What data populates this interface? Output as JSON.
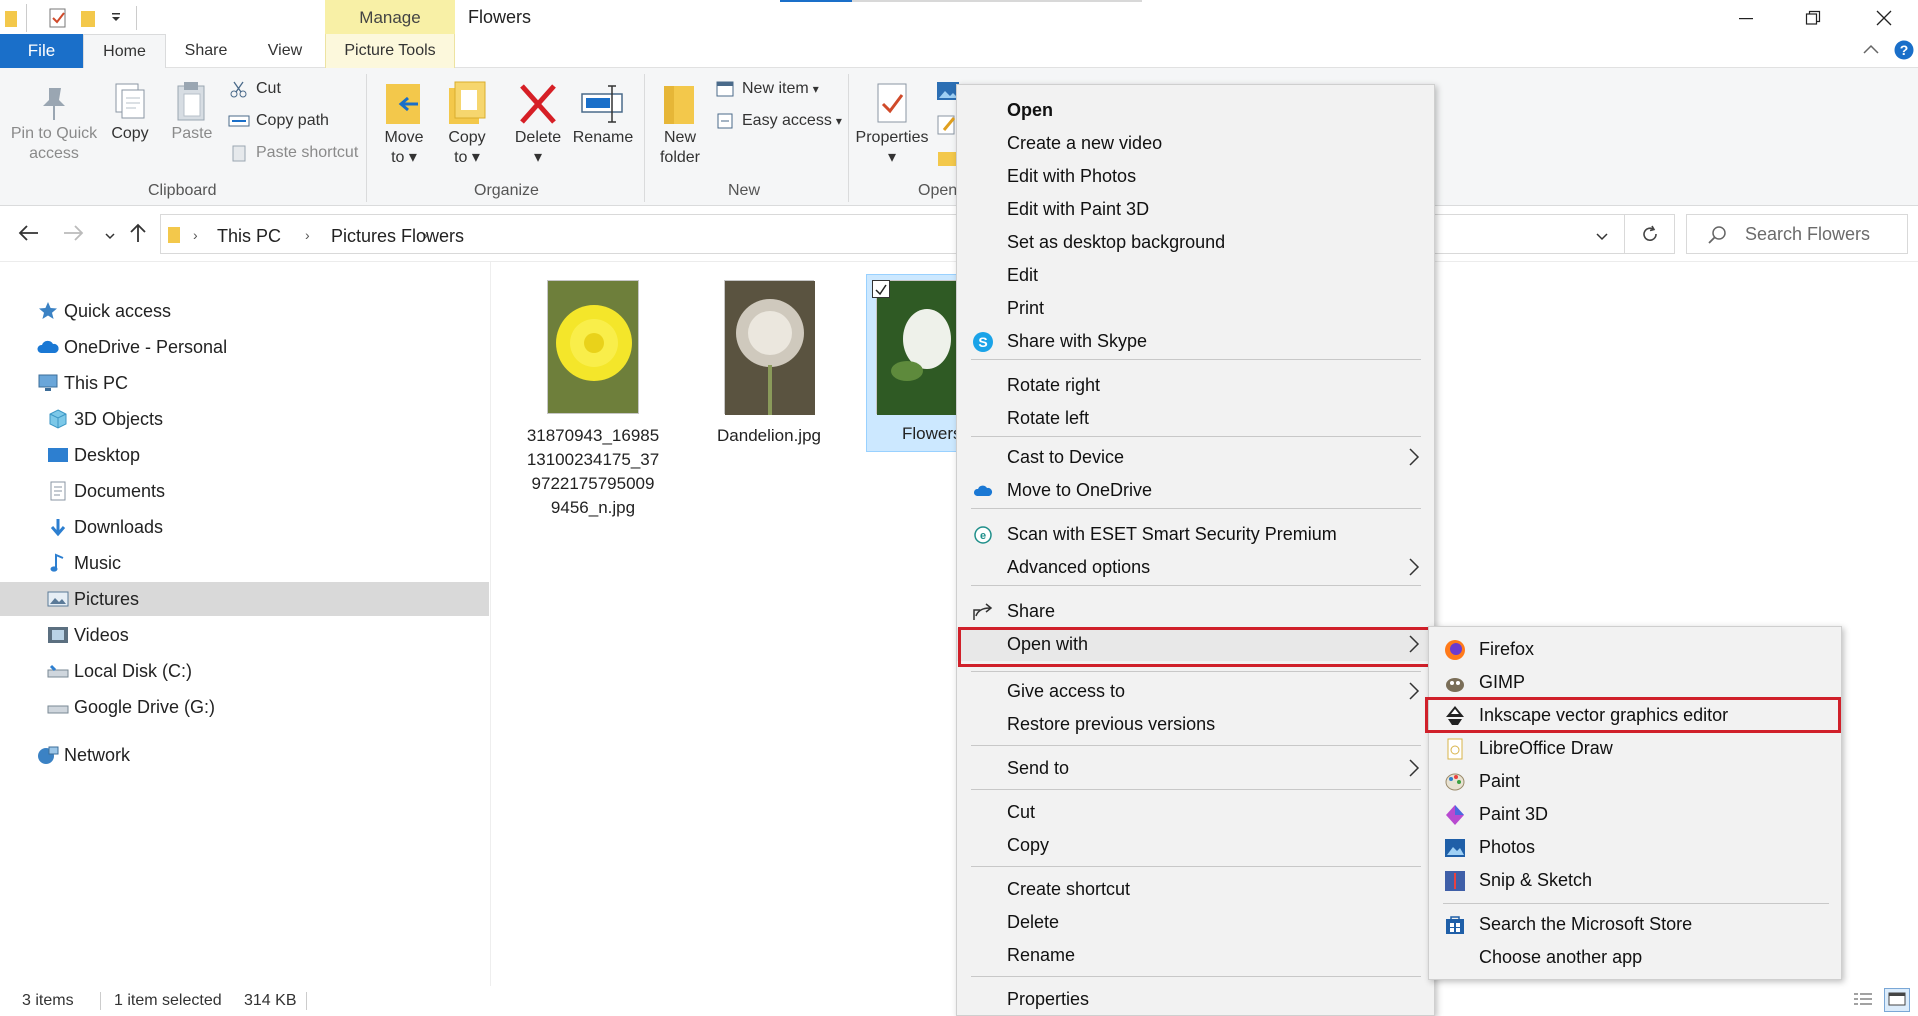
{
  "window": {
    "title": "Flowers",
    "contextual_group": "Manage",
    "accent_color": "#1a6fc9",
    "highlight_color": "#d0202a"
  },
  "tabs": {
    "file": "File",
    "home": "Home",
    "share": "Share",
    "view": "View",
    "picture_tools": "Picture Tools"
  },
  "ribbon": {
    "clipboard": {
      "group": "Clipboard",
      "pin_line1": "Pin to Quick",
      "pin_line2": "access",
      "copy": "Copy",
      "paste": "Paste",
      "cut": "Cut",
      "copy_path": "Copy path",
      "paste_shortcut": "Paste shortcut"
    },
    "organize": {
      "group": "Organize",
      "move_line1": "Move",
      "move_line2": "to",
      "copy_line1": "Copy",
      "copy_line2": "to",
      "delete": "Delete",
      "rename": "Rename"
    },
    "new": {
      "group": "New",
      "folder_line1": "New",
      "folder_line2": "folder",
      "new_item": "New item",
      "easy_access": "Easy access"
    },
    "open": {
      "group": "Open",
      "properties": "Properties"
    }
  },
  "address": {
    "crumbs": [
      "This PC",
      "Pictures",
      "Flowers"
    ],
    "search_placeholder": "Search Flowers"
  },
  "nav": {
    "items": [
      {
        "label": "Quick access"
      },
      {
        "label": "OneDrive - Personal"
      },
      {
        "label": "This PC"
      },
      {
        "label": "3D Objects"
      },
      {
        "label": "Desktop"
      },
      {
        "label": "Documents"
      },
      {
        "label": "Downloads"
      },
      {
        "label": "Music"
      },
      {
        "label": "Pictures"
      },
      {
        "label": "Videos"
      },
      {
        "label": "Local Disk (C:)"
      },
      {
        "label": "Google Drive (G:)"
      },
      {
        "label": "Network"
      }
    ]
  },
  "files": [
    {
      "line1": "31870943_16985",
      "line2": "13100234175_37",
      "line3": "9722175795009",
      "line4": "9456_n.jpg"
    },
    {
      "line1": "Dandelion.jpg"
    },
    {
      "line1": "Flowers"
    }
  ],
  "status": {
    "count": "3 items",
    "selection": "1 item selected",
    "size": "314 KB"
  },
  "context_menu": {
    "items": [
      "Open",
      "Create a new video",
      "Edit with Photos",
      "Edit with Paint 3D",
      "Set as desktop background",
      "Edit",
      "Print",
      "Share with Skype",
      "Rotate right",
      "Rotate left",
      "Cast to Device",
      "Move to OneDrive",
      "Scan with ESET Smart Security Premium",
      "Advanced options",
      "Share",
      "Open with",
      "Give access to",
      "Restore previous versions",
      "Send to",
      "Cut",
      "Copy",
      "Create shortcut",
      "Delete",
      "Rename",
      "Properties"
    ]
  },
  "open_with_menu": {
    "items": [
      "Firefox",
      "GIMP",
      "Inkscape vector graphics editor",
      "LibreOffice Draw",
      "Paint",
      "Paint 3D",
      "Photos",
      "Snip & Sketch",
      "Search the Microsoft Store",
      "Choose another app"
    ]
  }
}
